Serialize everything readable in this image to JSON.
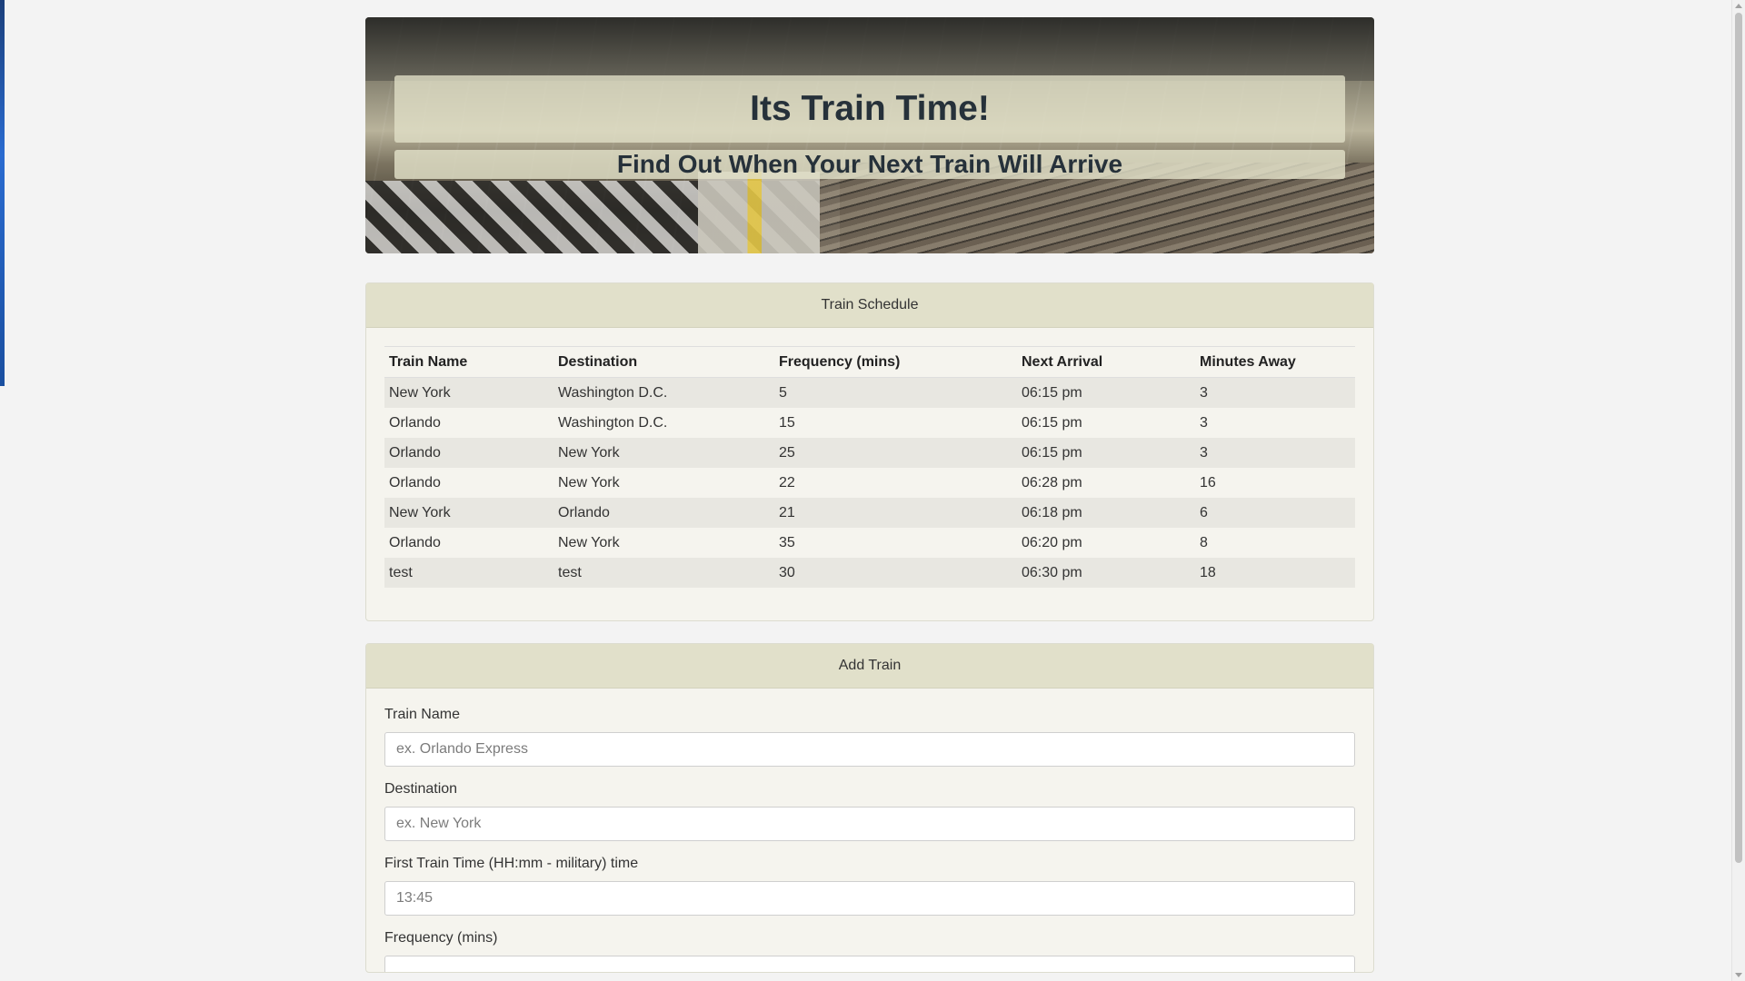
{
  "header": {
    "title": "Its Train Time!",
    "subtitle": "Find Out When Your Next Train Will Arrive"
  },
  "schedule": {
    "heading": "Train Schedule",
    "columns": [
      "Train Name",
      "Destination",
      "Frequency (mins)",
      "Next Arrival",
      "Minutes Away"
    ],
    "rows": [
      [
        "New York",
        "Washington D.C.",
        "5",
        "06:15 pm",
        "3"
      ],
      [
        "Orlando",
        "Washington D.C.",
        "15",
        "06:15 pm",
        "3"
      ],
      [
        "Orlando",
        "New York",
        "25",
        "06:15 pm",
        "3"
      ],
      [
        "Orlando",
        "New York",
        "22",
        "06:28 pm",
        "16"
      ],
      [
        "New York",
        "Orlando",
        "21",
        "06:18 pm",
        "6"
      ],
      [
        "Orlando",
        "New York",
        "35",
        "06:20 pm",
        "8"
      ],
      [
        "test",
        "test",
        "30",
        "06:30 pm",
        "18"
      ]
    ]
  },
  "add_train": {
    "heading": "Add Train",
    "fields": [
      {
        "label": "Train Name",
        "placeholder": "ex. Orlando Express"
      },
      {
        "label": "Destination",
        "placeholder": "ex. New York"
      },
      {
        "label": "First Train Time (HH:mm - military) time",
        "placeholder": "13:45"
      },
      {
        "label": "Frequency (mins)",
        "placeholder": ""
      }
    ]
  }
}
